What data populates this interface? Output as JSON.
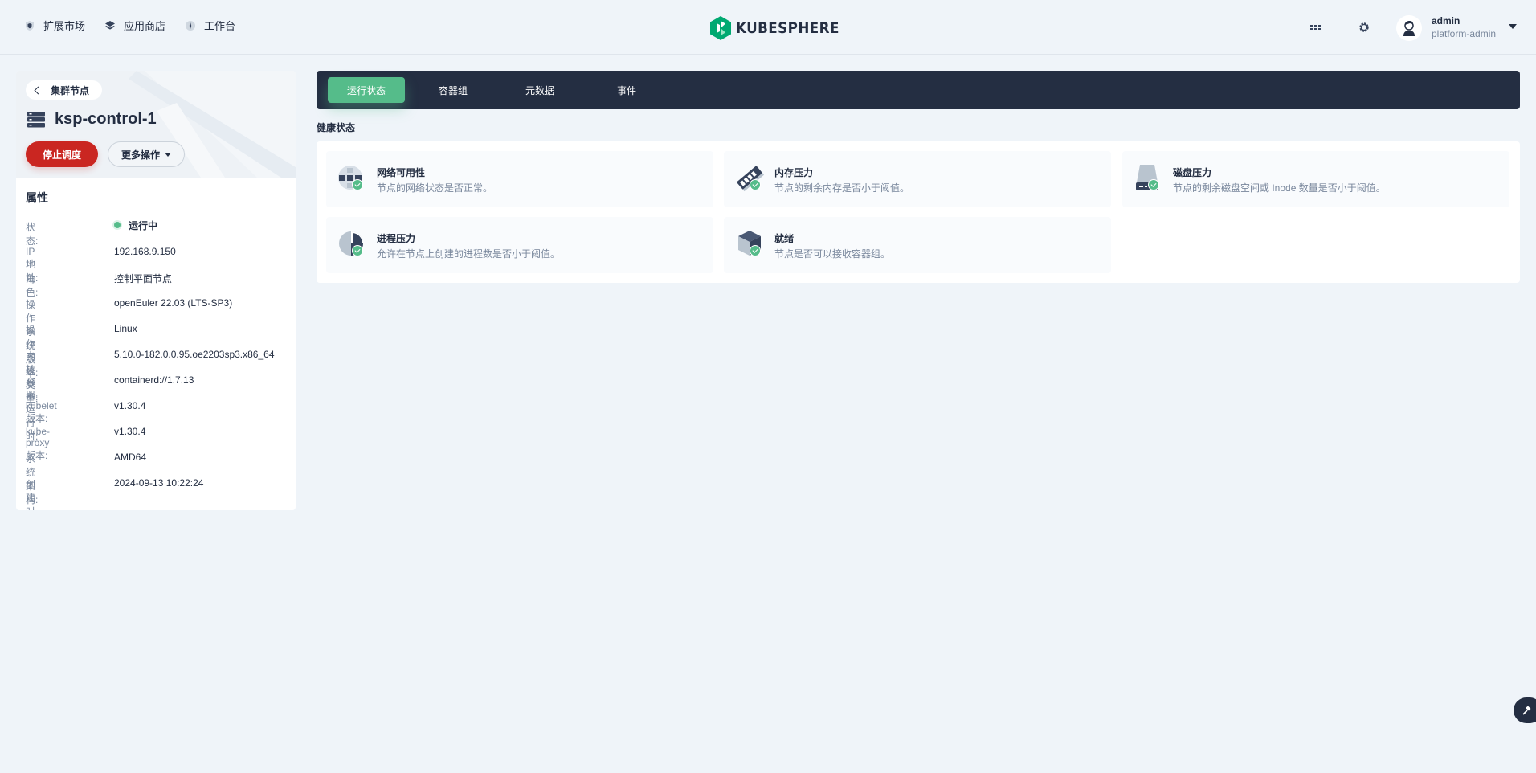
{
  "topbar": {
    "nav": [
      {
        "label": "扩展市场",
        "icon": "shield-icon"
      },
      {
        "label": "应用商店",
        "icon": "layers-icon"
      },
      {
        "label": "工作台",
        "icon": "compass-icon"
      }
    ],
    "logo_text": "KUBESPHERE",
    "user": {
      "name": "admin",
      "role": "platform-admin"
    }
  },
  "left": {
    "back_label": "集群节点",
    "node_name": "ksp-control-1",
    "stop_button": "停止调度",
    "more_button": "更多操作",
    "props_title": "属性",
    "props": [
      {
        "key": "状态:",
        "value": "运行中"
      },
      {
        "key": "IP 地址:",
        "value": "192.168.9.150"
      },
      {
        "key": "角色:",
        "value": "控制平面节点"
      },
      {
        "key": "操作系统版本:",
        "value": "openEuler 22.03 (LTS-SP3)"
      },
      {
        "key": "操作系统类型:",
        "value": "Linux"
      },
      {
        "key": "内核版本:",
        "value": "5.10.0-182.0.0.95.oe2203sp3.x86_64"
      },
      {
        "key": "容器运行时:",
        "value": "containerd://1.7.13"
      },
      {
        "key": "kubelet 版本:",
        "value": "v1.30.4"
      },
      {
        "key": "kube-proxy 版本:",
        "value": "v1.30.4"
      },
      {
        "key": "系统架构:",
        "value": "AMD64"
      },
      {
        "key": "创建时间:",
        "value": "2024-09-13 10:22:24"
      }
    ]
  },
  "tabs": [
    {
      "label": "运行状态",
      "active": true
    },
    {
      "label": "容器组",
      "active": false
    },
    {
      "label": "元数据",
      "active": false
    },
    {
      "label": "事件",
      "active": false
    }
  ],
  "health": {
    "title": "健康状态",
    "items": [
      {
        "title": "网络可用性",
        "desc": "节点的网络状态是否正常。",
        "icon": "network-icon"
      },
      {
        "title": "内存压力",
        "desc": "节点的剩余内存是否小于阈值。",
        "icon": "memory-icon"
      },
      {
        "title": "磁盘压力",
        "desc": "节点的剩余磁盘空间或 Inode 数量是否小于阈值。",
        "icon": "disk-icon"
      },
      {
        "title": "进程压力",
        "desc": "允许在节点上创建的进程数是否小于阈值。",
        "icon": "process-icon"
      },
      {
        "title": "就绪",
        "desc": "节点是否可以接收容器组。",
        "icon": "cube-icon"
      }
    ]
  },
  "colors": {
    "accent_green": "#55bc8a",
    "danger_red": "#ca2621",
    "dark": "#242e42",
    "muted": "#79879c",
    "page_bg": "#eff4f9"
  }
}
